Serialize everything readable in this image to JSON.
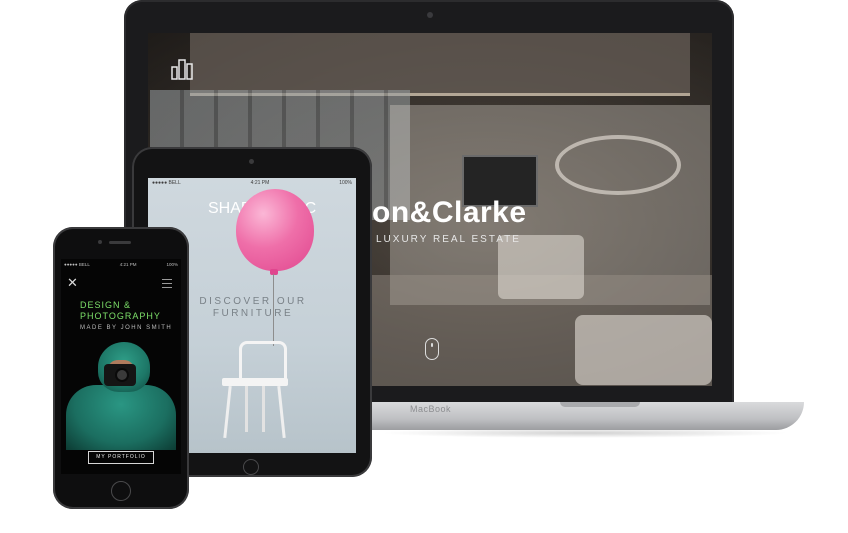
{
  "laptop": {
    "site": {
      "brand_name": "on&Clarke",
      "tagline": "LUXURY REAL ESTATE",
      "logo_icon": "building-icon",
      "scroll_icon": "mouse-scroll-icon"
    },
    "label": "MacBook"
  },
  "tablet": {
    "status_bar": {
      "left": "●●●●● BELL",
      "time": "4:21 PM",
      "right": "100%"
    },
    "site": {
      "brand_name": "SHABBY CHIC",
      "headline": "DISCOVER OUR FURNITURE"
    }
  },
  "phone": {
    "status_bar": {
      "left": "●●●●● BELL",
      "time": "4:21 PM",
      "right": "100%"
    },
    "site": {
      "close_icon": "close-icon",
      "menu_icon": "hamburger-menu-icon",
      "title": "DESIGN &\nPHOTOGRAPHY",
      "byline": "MADE BY JOHN SMITH",
      "cta_label": "MY PORTFOLIO"
    }
  },
  "colors": {
    "accent_green": "#7de06a",
    "balloon_pink": "#ef6fa9",
    "device_dark": "#131314"
  }
}
